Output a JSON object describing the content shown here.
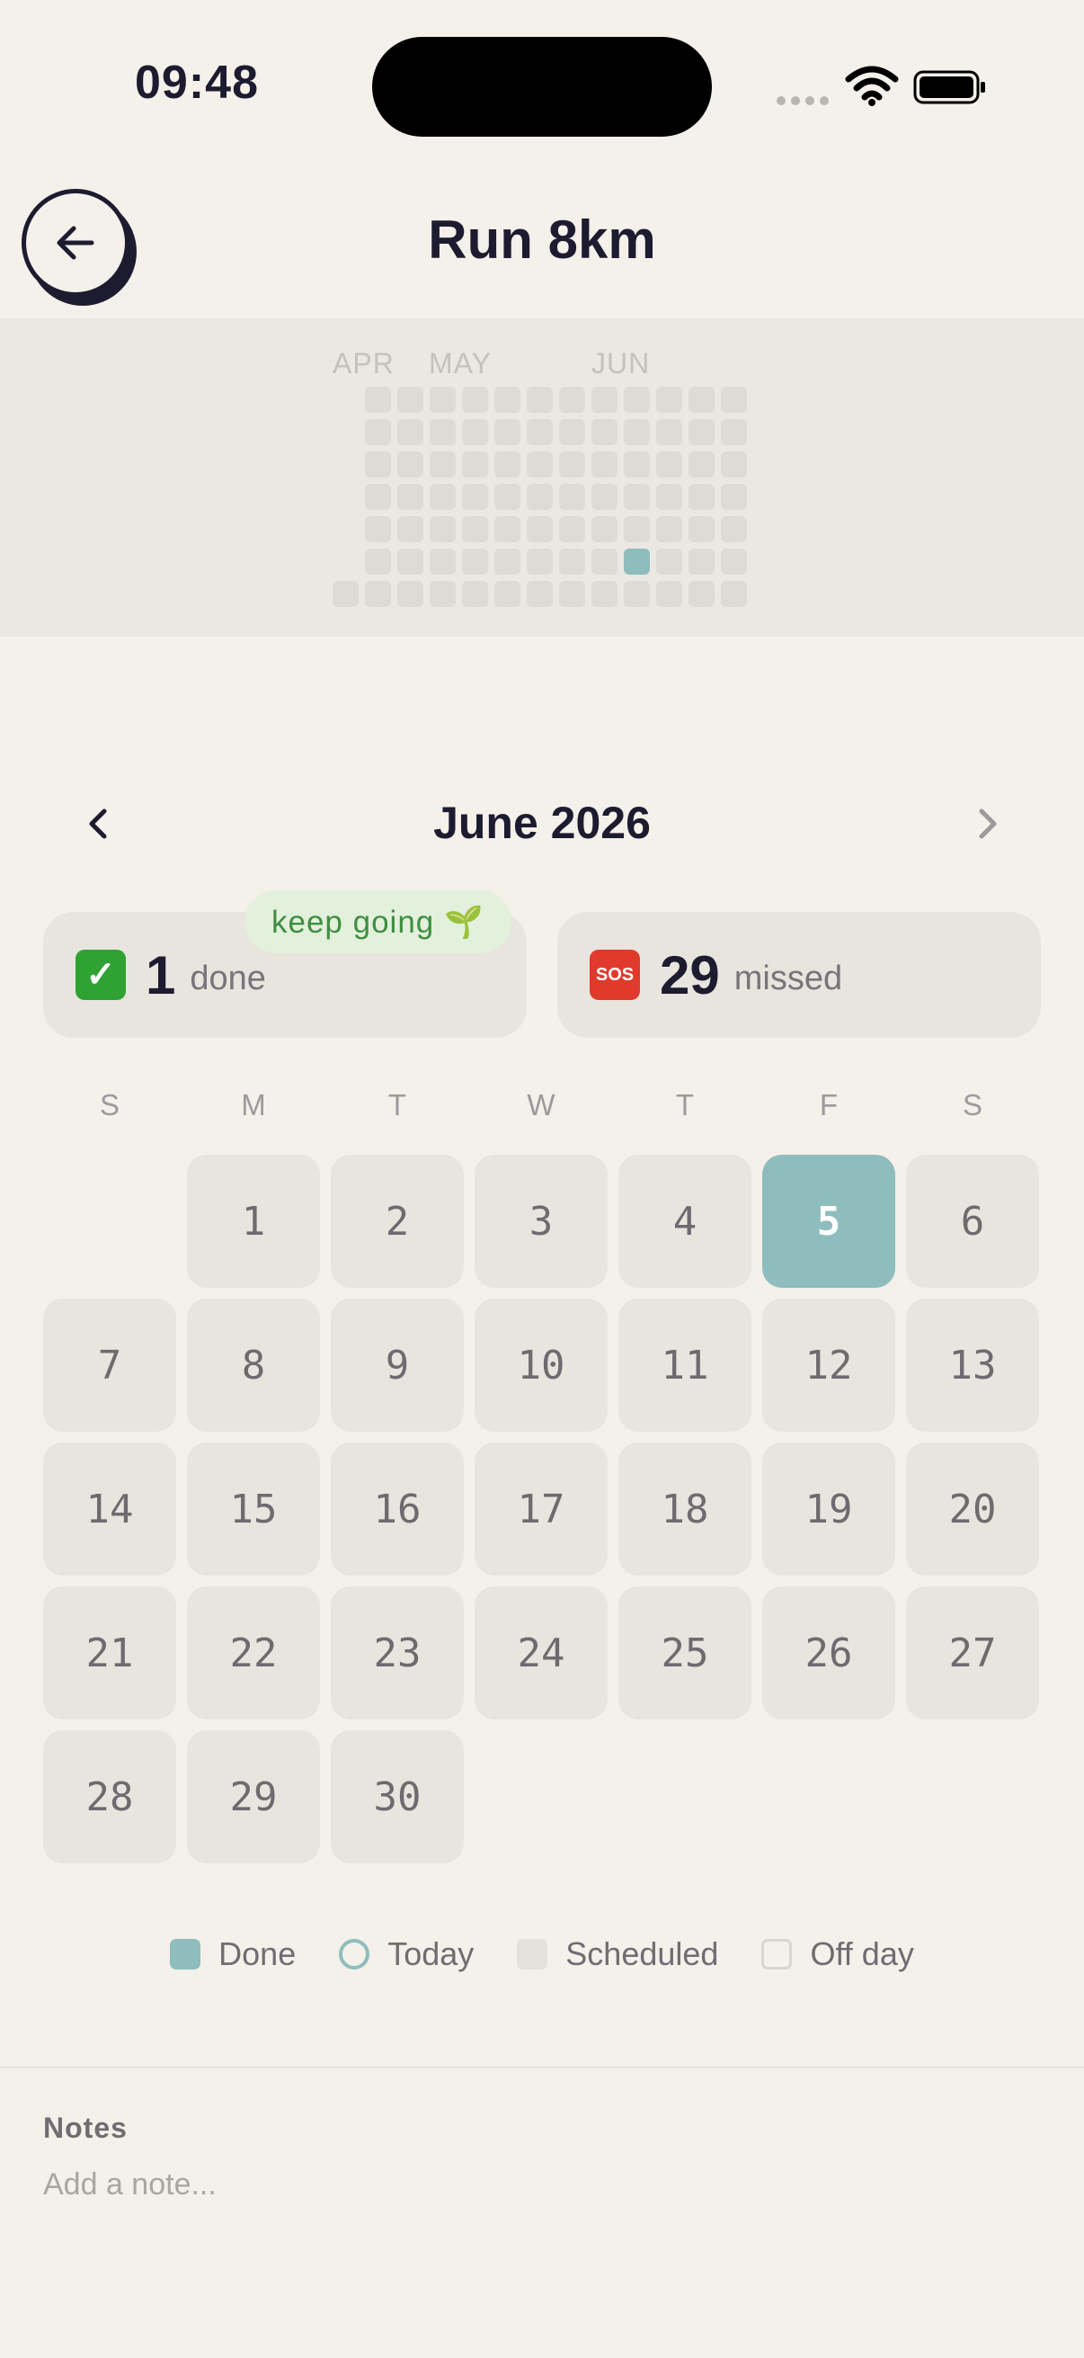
{
  "status_bar": {
    "time": "09:48"
  },
  "header": {
    "title": "Run 8km",
    "back_icon": "arrow-left-icon"
  },
  "heatmap": {
    "months": [
      "APR",
      "MAY",
      "JUN"
    ],
    "done_dates": [
      "2026-06-05"
    ]
  },
  "calendar": {
    "month_title": "June 2026",
    "weekdays": [
      "S",
      "M",
      "T",
      "W",
      "T",
      "F",
      "S"
    ],
    "days": [
      "1",
      "2",
      "3",
      "4",
      "5",
      "6",
      "7",
      "8",
      "9",
      "10",
      "11",
      "12",
      "13",
      "14",
      "15",
      "16",
      "17",
      "18",
      "19",
      "20",
      "21",
      "22",
      "23",
      "24",
      "25",
      "26",
      "27",
      "28",
      "29",
      "30"
    ],
    "first_weekday_index": 1,
    "done_days": [
      5
    ]
  },
  "stats": {
    "done_count": "1",
    "done_label": "done",
    "done_emoji": "✓",
    "missed_count": "29",
    "missed_label": "missed",
    "missed_emoji": "SOS",
    "badge": "keep going 🌱"
  },
  "legend": {
    "done": "Done",
    "today": "Today",
    "scheduled": "Scheduled",
    "off_day": "Off day"
  },
  "notes": {
    "label": "Notes",
    "placeholder": "Add a note..."
  },
  "colors": {
    "done": "#8fbdbd",
    "background": "#f4f0ea",
    "card": "#e8e4de",
    "badge_green": "#3e8f40"
  }
}
